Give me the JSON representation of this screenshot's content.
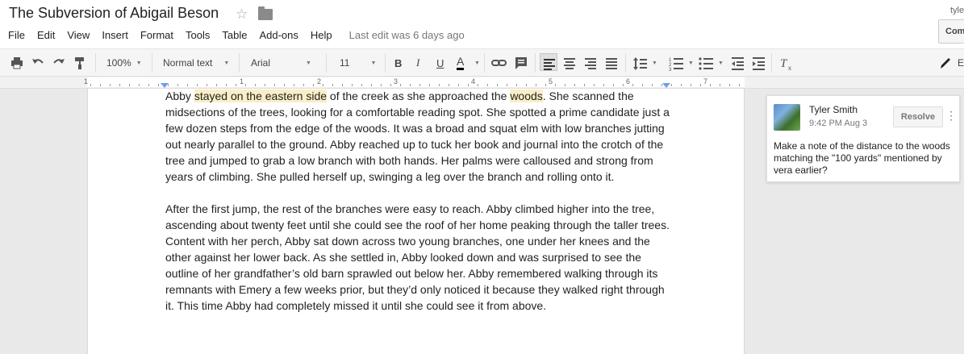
{
  "doc": {
    "title": "The Subversion of Abigail Beson",
    "user": "tyle"
  },
  "menu": {
    "items": [
      "File",
      "Edit",
      "View",
      "Insert",
      "Format",
      "Tools",
      "Table",
      "Add-ons",
      "Help"
    ],
    "last_edit": "Last edit was 6 days ago",
    "comments_button": "Comments"
  },
  "toolbar": {
    "zoom": "100%",
    "style": "Normal text",
    "font": "Arial",
    "size": "11",
    "bold": "B",
    "italic": "I",
    "underline": "U",
    "text_color": "A",
    "edit_mode": "E"
  },
  "ruler": {
    "numbers": [
      "1",
      "1",
      "2",
      "3",
      "4",
      "5",
      "6",
      "7"
    ]
  },
  "body": {
    "p1": {
      "pre": "Abby ",
      "hl1": "stayed on the eastern side",
      "mid": " of the creek as she approached the ",
      "hl2": "woods",
      "post": ". She scanned the midsections of the trees, looking for a comfortable reading spot. She spotted a prime candidate just a few dozen steps from the edge of the woods. It was a broad and squat elm with low branches jutting out nearly parallel to the ground. Abby reached up to tuck her book and journal into the crotch of the tree and jumped to grab a low branch with both hands. Her palms were calloused and strong from years of climbing. She pulled herself up, swinging a leg over the branch and rolling onto it."
    },
    "p2": "After the first jump, the rest of the branches were easy to reach. Abby climbed higher into the tree, ascending about twenty feet until she could see the roof of her home peaking through the taller trees. Content with her perch, Abby sat down across two young branches, one under her knees and the other against her lower back. As she settled in, Abby looked down and was surprised to see the outline of her grandfather’s old barn sprawled out below her.  Abby remembered walking through its remnants with Emery a few weeks prior, but they’d only noticed it because they walked right through it. This time Abby had completely missed it until she could see it from above."
  },
  "comment": {
    "author": "Tyler Smith",
    "time": "9:42 PM Aug 3",
    "resolve_label": "Resolve",
    "more": "⋮",
    "text": "Make a note of the distance to the woods matching the \"100 yards\" mentioned by vera earlier?"
  },
  "colors": {
    "highlight": "#fbeec6",
    "toolbar_bg": "#f5f5f5",
    "canvas_bg": "#e9e9e9",
    "ruler_marker": "#6d9eeb"
  },
  "icons": [
    "star-icon",
    "folder-icon",
    "print-icon",
    "undo-icon",
    "redo-icon",
    "paint-format-icon",
    "link-icon",
    "comment-icon",
    "align-left-icon",
    "align-center-icon",
    "align-right-icon",
    "justify-icon",
    "line-spacing-icon",
    "numbered-list-icon",
    "bulleted-list-icon",
    "decrease-indent-icon",
    "increase-indent-icon",
    "clear-formatting-icon",
    "pencil-icon"
  ]
}
